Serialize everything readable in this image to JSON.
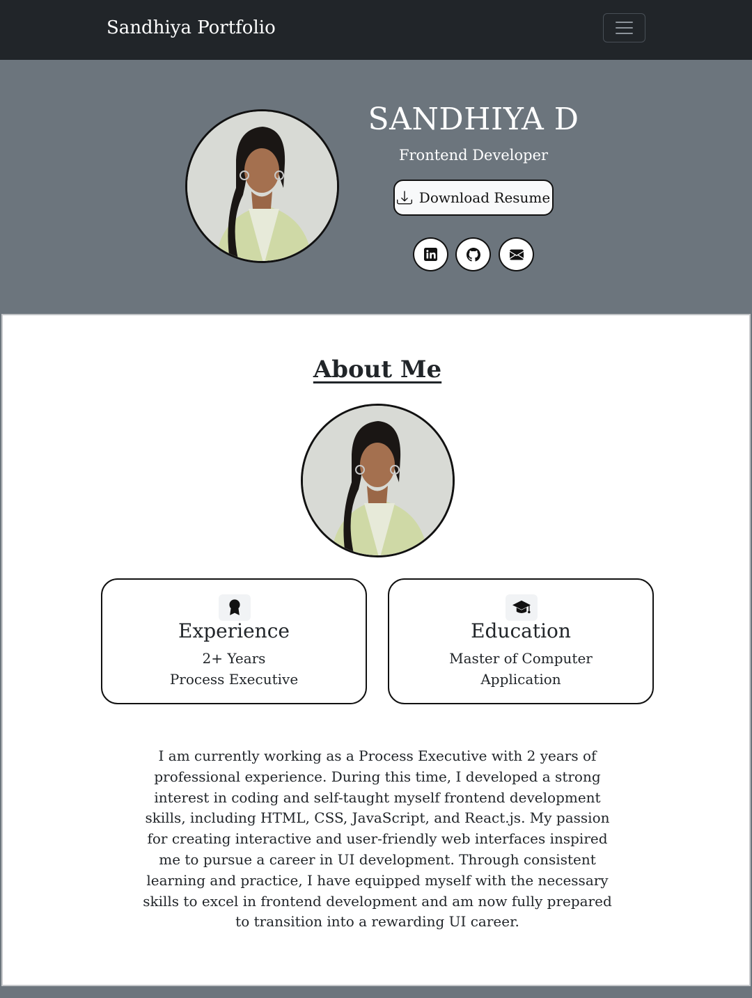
{
  "navbar": {
    "brand": "Sandhiya Portfolio",
    "menu_icon": "hamburger-menu-icon"
  },
  "hero": {
    "name": "SANDHIYA D",
    "role": "Frontend Developer",
    "resume_button": "Download Resume",
    "resume_icon": "download-icon",
    "social": [
      {
        "icon": "linkedin-icon"
      },
      {
        "icon": "github-icon"
      },
      {
        "icon": "envelope-icon"
      }
    ]
  },
  "about": {
    "title": "About Me",
    "cards": {
      "experience": {
        "icon": "award-icon",
        "title": "Experience",
        "line1": "2+ Years",
        "line2": "Process Executive"
      },
      "education": {
        "icon": "graduation-cap-icon",
        "title": "Education",
        "line1": "Master of Computer Application"
      }
    },
    "paragraph": "I am currently working as a Process Executive with 2 years of professional experience. During this time, I developed a strong interest in coding and self-taught myself frontend development skills, including HTML, CSS, JavaScript, and React.js. My passion for creating interactive and user-friendly web interfaces inspired me to pursue a career in UI development. Through consistent learning and practice, I have equipped myself with the necessary skills to excel in frontend development and am now fully prepared to transition into a rewarding UI career."
  },
  "colors": {
    "navbar_bg": "#212529",
    "hero_bg": "#6c757d",
    "card_bg": "#ffffff",
    "text": "#212529"
  }
}
